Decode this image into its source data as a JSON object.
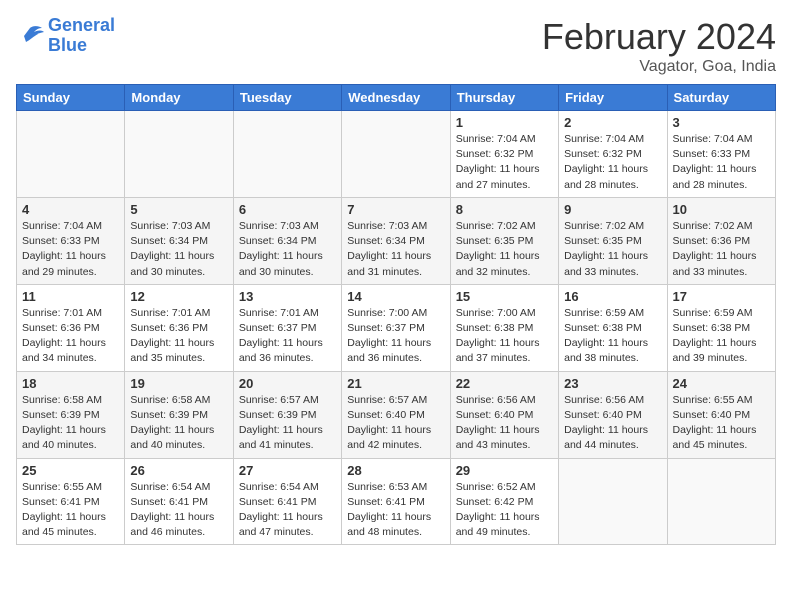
{
  "header": {
    "logo_line1": "General",
    "logo_line2": "Blue",
    "month": "February 2024",
    "location": "Vagator, Goa, India"
  },
  "weekdays": [
    "Sunday",
    "Monday",
    "Tuesday",
    "Wednesday",
    "Thursday",
    "Friday",
    "Saturday"
  ],
  "weeks": [
    [
      {
        "day": "",
        "info": ""
      },
      {
        "day": "",
        "info": ""
      },
      {
        "day": "",
        "info": ""
      },
      {
        "day": "",
        "info": ""
      },
      {
        "day": "1",
        "info": "Sunrise: 7:04 AM\nSunset: 6:32 PM\nDaylight: 11 hours\nand 27 minutes."
      },
      {
        "day": "2",
        "info": "Sunrise: 7:04 AM\nSunset: 6:32 PM\nDaylight: 11 hours\nand 28 minutes."
      },
      {
        "day": "3",
        "info": "Sunrise: 7:04 AM\nSunset: 6:33 PM\nDaylight: 11 hours\nand 28 minutes."
      }
    ],
    [
      {
        "day": "4",
        "info": "Sunrise: 7:04 AM\nSunset: 6:33 PM\nDaylight: 11 hours\nand 29 minutes."
      },
      {
        "day": "5",
        "info": "Sunrise: 7:03 AM\nSunset: 6:34 PM\nDaylight: 11 hours\nand 30 minutes."
      },
      {
        "day": "6",
        "info": "Sunrise: 7:03 AM\nSunset: 6:34 PM\nDaylight: 11 hours\nand 30 minutes."
      },
      {
        "day": "7",
        "info": "Sunrise: 7:03 AM\nSunset: 6:34 PM\nDaylight: 11 hours\nand 31 minutes."
      },
      {
        "day": "8",
        "info": "Sunrise: 7:02 AM\nSunset: 6:35 PM\nDaylight: 11 hours\nand 32 minutes."
      },
      {
        "day": "9",
        "info": "Sunrise: 7:02 AM\nSunset: 6:35 PM\nDaylight: 11 hours\nand 33 minutes."
      },
      {
        "day": "10",
        "info": "Sunrise: 7:02 AM\nSunset: 6:36 PM\nDaylight: 11 hours\nand 33 minutes."
      }
    ],
    [
      {
        "day": "11",
        "info": "Sunrise: 7:01 AM\nSunset: 6:36 PM\nDaylight: 11 hours\nand 34 minutes."
      },
      {
        "day": "12",
        "info": "Sunrise: 7:01 AM\nSunset: 6:36 PM\nDaylight: 11 hours\nand 35 minutes."
      },
      {
        "day": "13",
        "info": "Sunrise: 7:01 AM\nSunset: 6:37 PM\nDaylight: 11 hours\nand 36 minutes."
      },
      {
        "day": "14",
        "info": "Sunrise: 7:00 AM\nSunset: 6:37 PM\nDaylight: 11 hours\nand 36 minutes."
      },
      {
        "day": "15",
        "info": "Sunrise: 7:00 AM\nSunset: 6:38 PM\nDaylight: 11 hours\nand 37 minutes."
      },
      {
        "day": "16",
        "info": "Sunrise: 6:59 AM\nSunset: 6:38 PM\nDaylight: 11 hours\nand 38 minutes."
      },
      {
        "day": "17",
        "info": "Sunrise: 6:59 AM\nSunset: 6:38 PM\nDaylight: 11 hours\nand 39 minutes."
      }
    ],
    [
      {
        "day": "18",
        "info": "Sunrise: 6:58 AM\nSunset: 6:39 PM\nDaylight: 11 hours\nand 40 minutes."
      },
      {
        "day": "19",
        "info": "Sunrise: 6:58 AM\nSunset: 6:39 PM\nDaylight: 11 hours\nand 40 minutes."
      },
      {
        "day": "20",
        "info": "Sunrise: 6:57 AM\nSunset: 6:39 PM\nDaylight: 11 hours\nand 41 minutes."
      },
      {
        "day": "21",
        "info": "Sunrise: 6:57 AM\nSunset: 6:40 PM\nDaylight: 11 hours\nand 42 minutes."
      },
      {
        "day": "22",
        "info": "Sunrise: 6:56 AM\nSunset: 6:40 PM\nDaylight: 11 hours\nand 43 minutes."
      },
      {
        "day": "23",
        "info": "Sunrise: 6:56 AM\nSunset: 6:40 PM\nDaylight: 11 hours\nand 44 minutes."
      },
      {
        "day": "24",
        "info": "Sunrise: 6:55 AM\nSunset: 6:40 PM\nDaylight: 11 hours\nand 45 minutes."
      }
    ],
    [
      {
        "day": "25",
        "info": "Sunrise: 6:55 AM\nSunset: 6:41 PM\nDaylight: 11 hours\nand 45 minutes."
      },
      {
        "day": "26",
        "info": "Sunrise: 6:54 AM\nSunset: 6:41 PM\nDaylight: 11 hours\nand 46 minutes."
      },
      {
        "day": "27",
        "info": "Sunrise: 6:54 AM\nSunset: 6:41 PM\nDaylight: 11 hours\nand 47 minutes."
      },
      {
        "day": "28",
        "info": "Sunrise: 6:53 AM\nSunset: 6:41 PM\nDaylight: 11 hours\nand 48 minutes."
      },
      {
        "day": "29",
        "info": "Sunrise: 6:52 AM\nSunset: 6:42 PM\nDaylight: 11 hours\nand 49 minutes."
      },
      {
        "day": "",
        "info": ""
      },
      {
        "day": "",
        "info": ""
      }
    ]
  ]
}
